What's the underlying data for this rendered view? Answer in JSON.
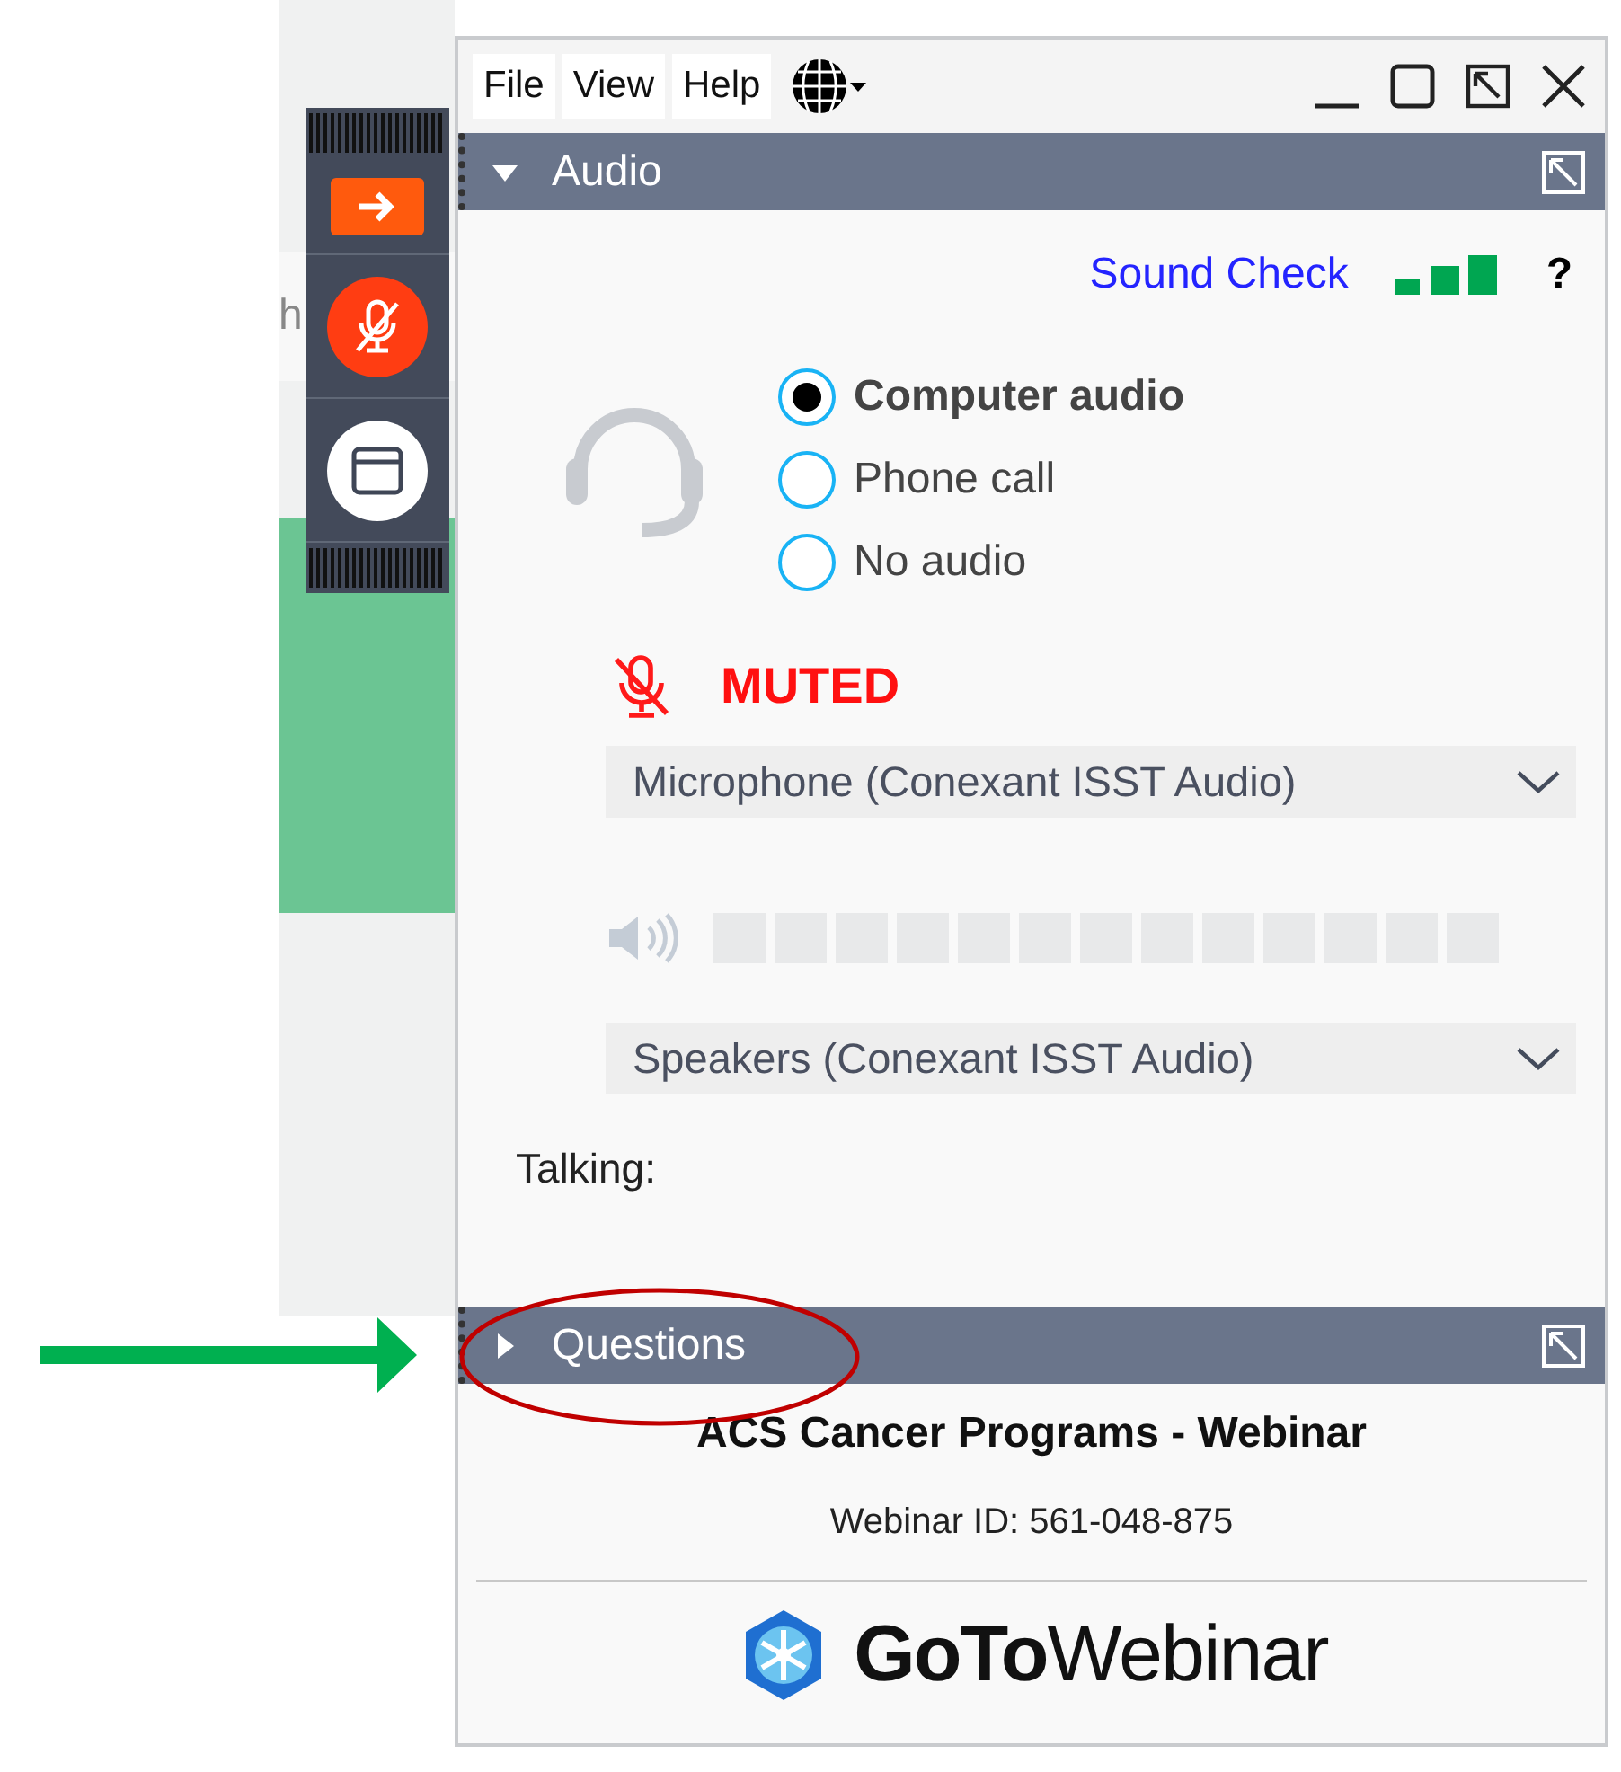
{
  "background": {
    "partial_text": "h"
  },
  "side_panel": {
    "buttons": [
      {
        "kind": "arrow"
      },
      {
        "kind": "mic_muted"
      },
      {
        "kind": "window"
      }
    ]
  },
  "window": {
    "menu": [
      "File",
      "View",
      "Help"
    ]
  },
  "audio_section": {
    "title": "Audio",
    "expanded": true,
    "sound_check": "Sound Check",
    "help": "?",
    "options": [
      {
        "label": "Computer audio",
        "selected": true
      },
      {
        "label": "Phone call",
        "selected": false
      },
      {
        "label": "No audio",
        "selected": false
      }
    ],
    "mute_status": "MUTED",
    "microphone": "Microphone (Conexant ISST Audio)",
    "speaker_meter": {
      "level": 0
    },
    "speakers": "Speakers (Conexant ISST Audio)",
    "talking_label": "Talking:"
  },
  "questions_section": {
    "title": "Questions",
    "expanded": false
  },
  "footer": {
    "title": "ACS Cancer Programs - Webinar",
    "webinar_id": "Webinar ID: 561-048-875",
    "logo_text": "**GoTo**Webinar"
  }
}
